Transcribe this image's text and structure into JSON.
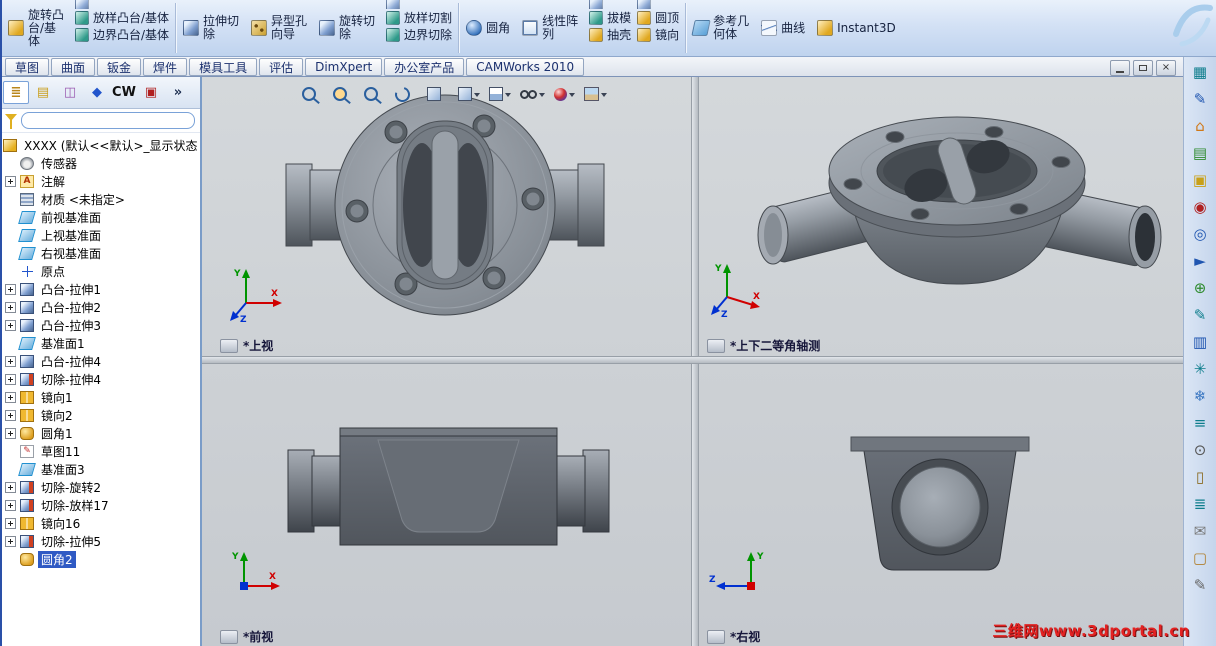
{
  "ribbon": {
    "buttons": {
      "revolve_boss": "旋转凸台/基体",
      "loft_boss": "放样凸台/基体",
      "boundary_boss": "边界凸台/基体",
      "extrude_cut": "拉伸切除",
      "hole_wizard": "异型孔向导",
      "revolve_cut": "旋转切除",
      "loft_cut": "放样切割",
      "boundary_cut": "边界切除",
      "fillet": "圆角",
      "linear_pattern": "线性阵列",
      "draft": "拔模",
      "shell": "抽壳",
      "dome": "圆顶",
      "mirror": "镜向",
      "reference_geometry": "参考几何体",
      "curves": "曲线",
      "instant3d": "Instant3D"
    }
  },
  "tabs": [
    {
      "label": "草图"
    },
    {
      "label": "曲面"
    },
    {
      "label": "钣金"
    },
    {
      "label": "焊件"
    },
    {
      "label": "模具工具"
    },
    {
      "label": "评估"
    },
    {
      "label": "DimXpert"
    },
    {
      "label": "办公室产品"
    },
    {
      "label": "CAMWorks 2010"
    }
  ],
  "window_controls": {
    "close": "×"
  },
  "panel": {
    "toolbar_icons": [
      {
        "name": "featuremanager-tree-icon",
        "glyph": "≣",
        "color": "#b9861a",
        "active": true
      },
      {
        "name": "propertymanager-icon",
        "glyph": "▤",
        "color": "#caa020"
      },
      {
        "name": "configurationmanager-icon",
        "glyph": "◫",
        "color": "#9a5ab0"
      },
      {
        "name": "dimxpertmanager-icon",
        "glyph": "◆",
        "color": "#2255cc"
      },
      {
        "name": "camworks-feature-tree-icon",
        "glyph": "CW",
        "color": "#111111"
      },
      {
        "name": "camworks-operation-tree-icon",
        "glyph": "▣",
        "color": "#b02020"
      },
      {
        "name": "panel-overflow-icon",
        "glyph": "»",
        "color": "#223355"
      }
    ],
    "filter_value": "",
    "tree": {
      "root": "XXXX (默认<<默认>_显示状态",
      "items": [
        {
          "label": "传感器",
          "icon": "sensor"
        },
        {
          "label": "注解",
          "icon": "annotation",
          "expand": true
        },
        {
          "label": "材质 <未指定>",
          "icon": "material"
        },
        {
          "label": "前视基准面",
          "icon": "plane"
        },
        {
          "label": "上视基准面",
          "icon": "plane"
        },
        {
          "label": "右视基准面",
          "icon": "plane"
        },
        {
          "label": "原点",
          "icon": "origin"
        },
        {
          "label": "凸台-拉伸1",
          "icon": "boss",
          "expand": true
        },
        {
          "label": "凸台-拉伸2",
          "icon": "boss",
          "expand": true
        },
        {
          "label": "凸台-拉伸3",
          "icon": "boss",
          "expand": true
        },
        {
          "label": "基准面1",
          "icon": "plane"
        },
        {
          "label": "凸台-拉伸4",
          "icon": "boss",
          "expand": true
        },
        {
          "label": "切除-拉伸4",
          "icon": "cut",
          "expand": true
        },
        {
          "label": "镜向1",
          "icon": "mirror",
          "expand": true
        },
        {
          "label": "镜向2",
          "icon": "mirror",
          "expand": true
        },
        {
          "label": "圆角1",
          "icon": "fillet",
          "expand": true
        },
        {
          "label": "草图11",
          "icon": "sketch"
        },
        {
          "label": "基准面3",
          "icon": "plane"
        },
        {
          "label": "切除-旋转2",
          "icon": "cut",
          "expand": true
        },
        {
          "label": "切除-放样17",
          "icon": "cut",
          "expand": true
        },
        {
          "label": "镜向16",
          "icon": "mirror",
          "expand": true
        },
        {
          "label": "切除-拉伸5",
          "icon": "cut",
          "expand": true
        },
        {
          "label": "圆角2",
          "icon": "fillet",
          "selected": true
        }
      ]
    }
  },
  "hud": {
    "icons": [
      {
        "name": "zoom-fit-icon",
        "type": "mag"
      },
      {
        "name": "zoom-area-icon",
        "type": "magarea"
      },
      {
        "name": "zoom-inout-icon",
        "type": "mag"
      },
      {
        "name": "rotate-view-icon",
        "type": "rot"
      },
      {
        "name": "section-view-icon",
        "type": "cube"
      },
      {
        "name": "view-orientation-icon",
        "type": "cube",
        "arrow": true
      },
      {
        "name": "display-style-icon",
        "type": "cube2",
        "arrow": true
      },
      {
        "name": "hide-show-items-icon",
        "type": "glasses",
        "arrow": true
      },
      {
        "name": "edit-appearance-icon",
        "type": "ball",
        "arrow": true
      },
      {
        "name": "apply-scene-icon",
        "type": "scene",
        "arrow": true
      }
    ]
  },
  "right_toolbar": {
    "icons": [
      {
        "name": "grid-icon",
        "glyph": "▦",
        "color": "#0d7d8c"
      },
      {
        "name": "pencil-icon",
        "glyph": "✎",
        "color": "#1f55b0"
      },
      {
        "name": "home-icon",
        "glyph": "⌂",
        "color": "#d07818"
      },
      {
        "name": "design-library-icon",
        "glyph": "▤",
        "color": "#2e8b2e"
      },
      {
        "name": "file-explorer-icon",
        "glyph": "▣",
        "color": "#c8a018"
      },
      {
        "name": "search-icon",
        "glyph": "◉",
        "color": "#b02020"
      },
      {
        "name": "view-palette-icon",
        "glyph": "◎",
        "color": "#1f55b0"
      },
      {
        "name": "arrow-icon",
        "glyph": "►",
        "color": "#1f55b0"
      },
      {
        "name": "appearances-icon",
        "glyph": "⊕",
        "color": "#2e8b2e"
      },
      {
        "name": "scene-pencil-icon",
        "glyph": "✎",
        "color": "#0d7d8c"
      },
      {
        "name": "custom-properties-icon",
        "glyph": "▥",
        "color": "#1f55b0"
      },
      {
        "name": "asterisk-icon",
        "glyph": "✳",
        "color": "#0d7d8c"
      },
      {
        "name": "snowflake-icon",
        "glyph": "❄",
        "color": "#3a77c2"
      },
      {
        "name": "ruler-icon",
        "glyph": "≡",
        "color": "#0d7d8c"
      },
      {
        "name": "eye-icon",
        "glyph": "⊙",
        "color": "#555555"
      },
      {
        "name": "doc-icon",
        "glyph": "▯",
        "color": "#8a6a20"
      },
      {
        "name": "layers-icon",
        "glyph": "≣",
        "color": "#0d7d8c"
      },
      {
        "name": "mail-icon",
        "glyph": "✉",
        "color": "#777777"
      },
      {
        "name": "note-icon",
        "glyph": "▢",
        "color": "#b08030"
      },
      {
        "name": "edit-icon",
        "glyph": "✎",
        "color": "#666666"
      }
    ]
  },
  "views": {
    "top_left": {
      "label": "*上视"
    },
    "top_right": {
      "label": "*上下二等角轴测"
    },
    "bottom_left": {
      "label": "*前视"
    },
    "bottom_right": {
      "label": "*右视"
    }
  },
  "triad": {
    "x": "X",
    "y": "Y",
    "z": "Z"
  },
  "watermark": "三维网www.3dportal.cn"
}
